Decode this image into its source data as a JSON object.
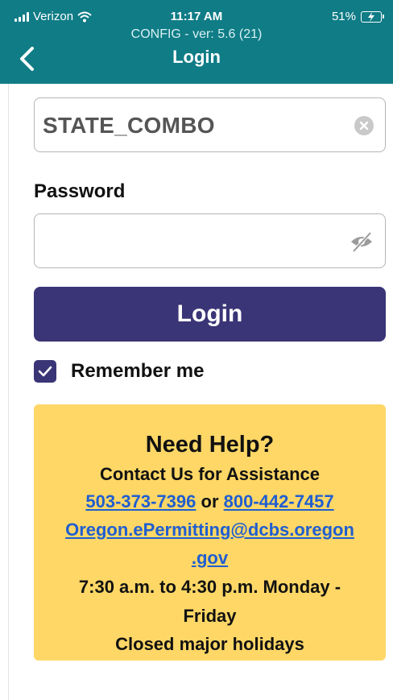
{
  "status_bar": {
    "carrier": "Verizon",
    "time": "11:17 AM",
    "battery": "51%",
    "battery_color": "#5fdc4c"
  },
  "header": {
    "version": "CONFIG - ver: 5.6 (21)",
    "title": "Login",
    "background": "#0f7c86"
  },
  "form": {
    "username_value": "STATE_COMBO",
    "password_label": "Password",
    "password_value": "",
    "login_button": "Login",
    "remember_label": "Remember me",
    "remember_checked": true,
    "accent": "#3a3576"
  },
  "help": {
    "title": "Need Help?",
    "subtitle": "Contact Us for Assistance",
    "phone1": "503-373-7396",
    "phone_separator": "or",
    "phone2": "800-442-7457",
    "email_part1": "Oregon.ePermitting@dcbs.oregon",
    "email_part2": ".gov",
    "hours_line1": "7:30 a.m. to 4:30 p.m. Monday -",
    "hours_line2": "Friday",
    "closed": "Closed major holidays",
    "background": "#fed766",
    "link_color": "#1f5ed1"
  },
  "icons": [
    "signal-icon",
    "wifi-icon",
    "back-chevron-icon",
    "clear-icon",
    "eye-slash-icon",
    "check-icon",
    "charging-icon"
  ]
}
